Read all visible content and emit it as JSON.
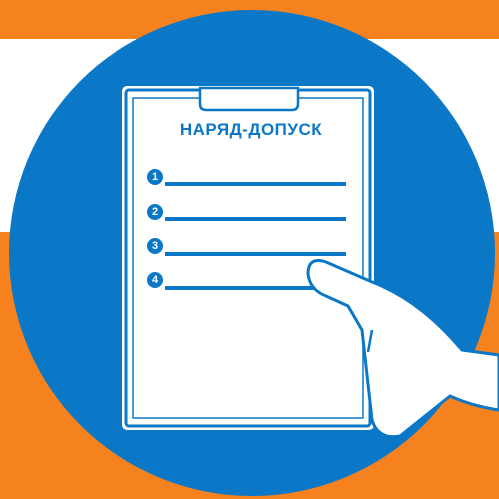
{
  "document": {
    "title": "НАРЯД-ДОПУСК",
    "items": [
      {
        "number": "1"
      },
      {
        "number": "2"
      },
      {
        "number": "3"
      },
      {
        "number": "4"
      }
    ]
  },
  "colors": {
    "background": "#f5821f",
    "band": "#ffffff",
    "circle": "#0b78c7",
    "paper": "#ffffff",
    "accent": "#0b78c7"
  },
  "icons": [
    "clipboard-icon",
    "hand-icon"
  ]
}
